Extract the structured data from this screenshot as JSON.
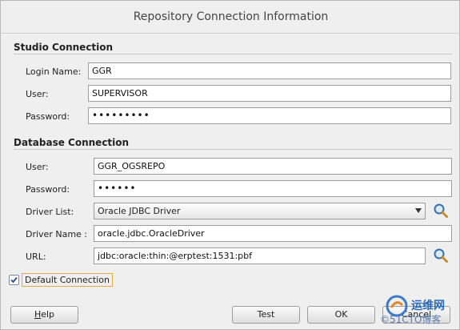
{
  "dialog": {
    "title": "Repository Connection Information"
  },
  "studio": {
    "section_title": "Studio Connection",
    "login_name_label": "Login Name:",
    "login_name_value": "GGR",
    "user_label": "User:",
    "user_value": "SUPERVISOR",
    "password_label": "Password:",
    "password_mask": "•••••••••"
  },
  "database": {
    "section_title": "Database Connection",
    "user_label": "User:",
    "user_value": "GGR_OGSREPO",
    "password_label": "Password:",
    "password_mask": "••••••",
    "driver_list_label": "Driver List:",
    "driver_list_value": "Oracle JDBC Driver",
    "driver_name_label": "Driver Name :",
    "driver_name_value": "oracle.jdbc.OracleDriver",
    "url_label": "URL:",
    "url_value": "jdbc:oracle:thin:@erptest:1531:pbf"
  },
  "options": {
    "default_connection_label": "Default Connection",
    "default_connection_checked": true
  },
  "buttons": {
    "help_mnemonic": "H",
    "help_rest": "elp",
    "test": "Test",
    "ok": "OK",
    "cancel": "Cancel"
  },
  "watermark": {
    "line1": "运维网",
    "line2": "©51CTO博客"
  },
  "icons": {
    "search": "search-icon",
    "dropdown": "chevron-down-icon",
    "check": "checkmark-icon"
  },
  "colors": {
    "focus_border": "#e8a64a",
    "checkbox_border": "#7a8aa8",
    "watermark_blue": "#2a6ab8"
  }
}
